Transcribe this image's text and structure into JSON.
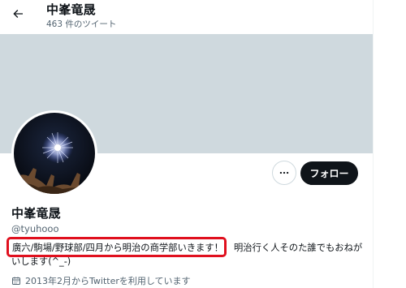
{
  "header": {
    "back_icon": "arrow-left-icon",
    "name": "中峯竜晟",
    "tweet_count": "463 件のツイート"
  },
  "colors": {
    "banner": "#cfd9de",
    "follow_button": "#0f1419",
    "highlight": "#e0101e",
    "secondary_text": "#536471"
  },
  "profile": {
    "name": "中峯竜晟",
    "handle": "@tyuhooo",
    "bio_highlighted": "廣六/駒場/野球部/四月から明治の商学部いきます！",
    "bio_rest": "明治行く人そのた誰でもおねが",
    "bio_line2": "いします(^_-)",
    "joined": "2013年2月からTwitterを利用しています",
    "joined_icon": "calendar-icon"
  },
  "actions": {
    "more_icon": "more-dots-icon",
    "follow_label": "フォロー"
  }
}
